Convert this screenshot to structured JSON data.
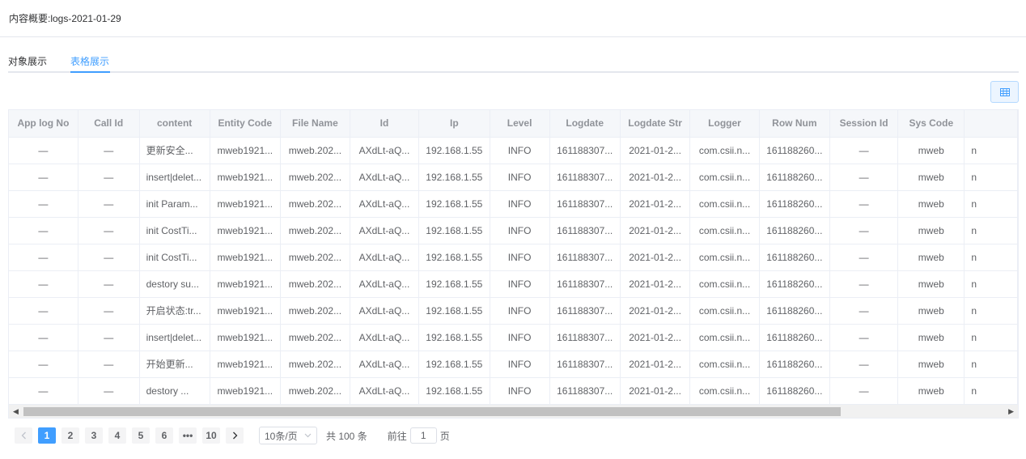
{
  "header": {
    "title": "内容概要:logs-2021-01-29"
  },
  "tabs": [
    {
      "label": "对象展示",
      "active": false
    },
    {
      "label": "表格展示",
      "active": true
    }
  ],
  "colors": {
    "accent": "#409eff",
    "header_bg": "#f5f7fa",
    "border": "#ebeef5"
  },
  "table": {
    "columns": [
      "App log No",
      "Call Id",
      "content",
      "Entity Code",
      "File Name",
      "Id",
      "Ip",
      "Level",
      "Logdate",
      "Logdate Str",
      "Logger",
      "Row Num",
      "Session Id",
      "Sys Code",
      ""
    ],
    "rows": [
      [
        "—",
        "—",
        "更新安全...",
        "mweb1921...",
        "mweb.202...",
        "AXdLt-aQ...",
        "192.168.1.55",
        "INFO",
        "161188307...",
        "2021-01-2...",
        "com.csii.n...",
        "161188260...",
        "—",
        "mweb",
        "n"
      ],
      [
        "—",
        "—",
        "insert|delet...",
        "mweb1921...",
        "mweb.202...",
        "AXdLt-aQ...",
        "192.168.1.55",
        "INFO",
        "161188307...",
        "2021-01-2...",
        "com.csii.n...",
        "161188260...",
        "—",
        "mweb",
        "n"
      ],
      [
        "—",
        "—",
        "init Param...",
        "mweb1921...",
        "mweb.202...",
        "AXdLt-aQ...",
        "192.168.1.55",
        "INFO",
        "161188307...",
        "2021-01-2...",
        "com.csii.n...",
        "161188260...",
        "—",
        "mweb",
        "n"
      ],
      [
        "—",
        "—",
        "init CostTi...",
        "mweb1921...",
        "mweb.202...",
        "AXdLt-aQ...",
        "192.168.1.55",
        "INFO",
        "161188307...",
        "2021-01-2...",
        "com.csii.n...",
        "161188260...",
        "—",
        "mweb",
        "n"
      ],
      [
        "—",
        "—",
        "init CostTi...",
        "mweb1921...",
        "mweb.202...",
        "AXdLt-aQ...",
        "192.168.1.55",
        "INFO",
        "161188307...",
        "2021-01-2...",
        "com.csii.n...",
        "161188260...",
        "—",
        "mweb",
        "n"
      ],
      [
        "—",
        "—",
        "destory su...",
        "mweb1921...",
        "mweb.202...",
        "AXdLt-aQ...",
        "192.168.1.55",
        "INFO",
        "161188307...",
        "2021-01-2...",
        "com.csii.n...",
        "161188260...",
        "—",
        "mweb",
        "n"
      ],
      [
        "—",
        "—",
        "开启状态:tr...",
        "mweb1921...",
        "mweb.202...",
        "AXdLt-aQ...",
        "192.168.1.55",
        "INFO",
        "161188307...",
        "2021-01-2...",
        "com.csii.n...",
        "161188260...",
        "—",
        "mweb",
        "n"
      ],
      [
        "—",
        "—",
        "insert|delet...",
        "mweb1921...",
        "mweb.202...",
        "AXdLt-aQ...",
        "192.168.1.55",
        "INFO",
        "161188307...",
        "2021-01-2...",
        "com.csii.n...",
        "161188260...",
        "—",
        "mweb",
        "n"
      ],
      [
        "—",
        "—",
        "开始更新...",
        "mweb1921...",
        "mweb.202...",
        "AXdLt-aQ...",
        "192.168.1.55",
        "INFO",
        "161188307...",
        "2021-01-2...",
        "com.csii.n...",
        "161188260...",
        "—",
        "mweb",
        "n"
      ],
      [
        "—",
        "—",
        "destory ...",
        "mweb1921...",
        "mweb.202...",
        "AXdLt-aQ...",
        "192.168.1.55",
        "INFO",
        "161188307...",
        "2021-01-2...",
        "com.csii.n...",
        "161188260...",
        "—",
        "mweb",
        "n"
      ]
    ]
  },
  "pagination": {
    "prev_icon": "chevron-left-icon",
    "next_icon": "chevron-right-icon",
    "pages": [
      "1",
      "2",
      "3",
      "4",
      "5",
      "6",
      "•••",
      "10"
    ],
    "current_page": "1",
    "page_size": "10条/页",
    "total": "共 100 条",
    "goto_prefix": "前往",
    "goto_value": "1",
    "goto_suffix": "页"
  }
}
